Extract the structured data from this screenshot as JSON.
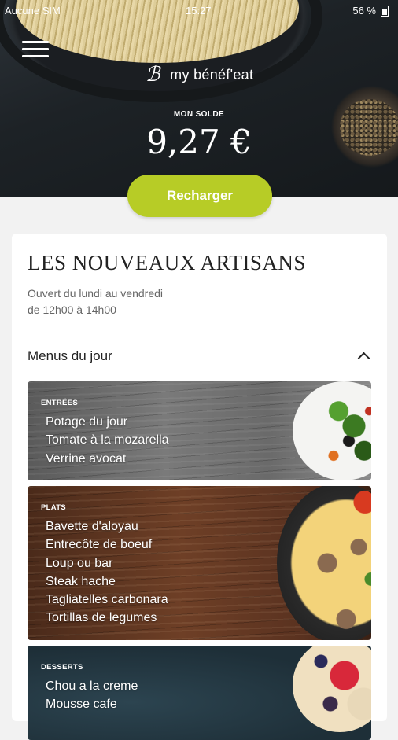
{
  "status_bar": {
    "carrier": "Aucune SIM",
    "time": "15:27",
    "battery": "56 %"
  },
  "header": {
    "logo_text": "ℬ",
    "app_name": "my bénéf'eat",
    "balance_label": "MON SOLDE",
    "balance_value": "9,27 €",
    "recharge_label": "Recharger"
  },
  "restaurant": {
    "name": "LES NOUVEAUX ARTISANS",
    "hours_line1": "Ouvert du lundi au vendredi",
    "hours_line2": "de 12h00 à 14h00"
  },
  "menus": {
    "title": "Menus du jour",
    "sections": [
      {
        "label": "ENTRÉES",
        "items": [
          "Potage du jour",
          "Tomate à la mozarella",
          "Verrine avocat"
        ]
      },
      {
        "label": "PLATS",
        "items": [
          "Bavette d'aloyau",
          "Entrecôte de boeuf",
          "Loup ou bar",
          "Steak hache",
          "Tagliatelles carbonara",
          "Tortillas de legumes"
        ]
      },
      {
        "label": "DESSERTS",
        "items": [
          "Chou a la creme",
          "Mousse cafe"
        ]
      }
    ]
  }
}
